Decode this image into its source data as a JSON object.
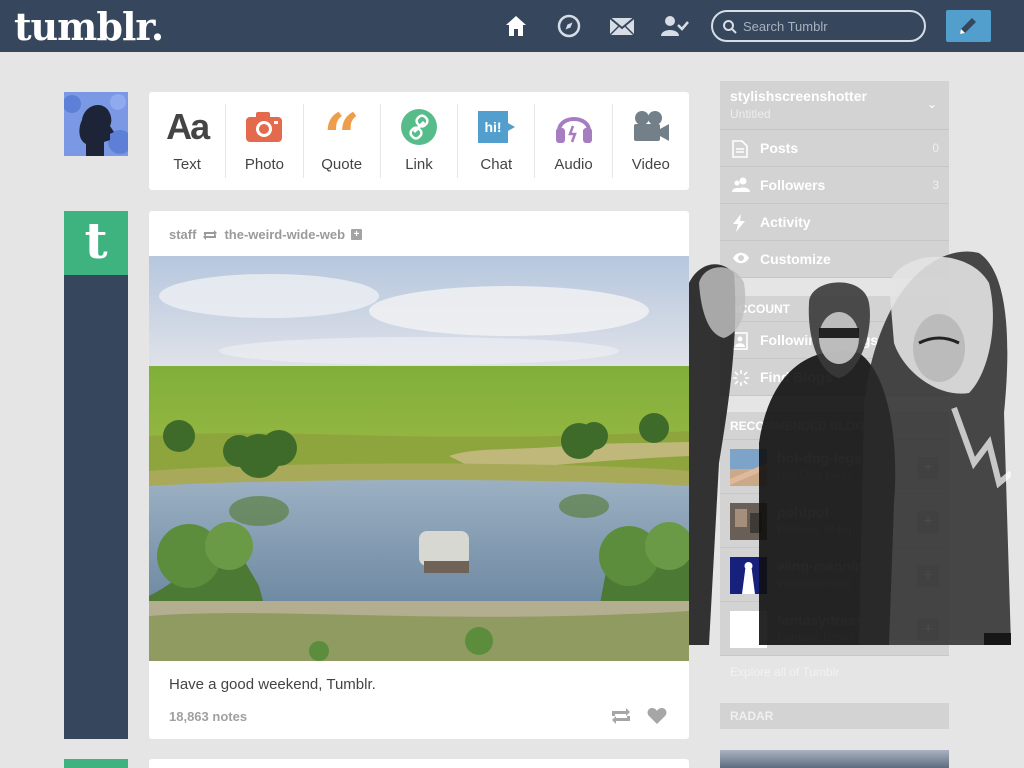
{
  "header": {
    "logo": "tumblr.",
    "search_placeholder": "Search Tumblr",
    "nav_icons": [
      "home-icon",
      "compass-icon",
      "mail-icon",
      "account-icon"
    ],
    "compose_icon": "pencil-icon",
    "colors": {
      "bar": "#36465d",
      "compose": "#529ecc"
    }
  },
  "post_types": [
    {
      "label": "Text",
      "icon": "text-icon",
      "color": "#444444"
    },
    {
      "label": "Photo",
      "icon": "camera-icon",
      "color": "#e46a4e"
    },
    {
      "label": "Quote",
      "icon": "quote-icon",
      "color": "#ef9d4b"
    },
    {
      "label": "Link",
      "icon": "link-icon",
      "color": "#56bc8a"
    },
    {
      "label": "Chat",
      "icon": "chat-icon",
      "color": "#529ecc"
    },
    {
      "label": "Audio",
      "icon": "headphones-icon",
      "color": "#a77dc2"
    },
    {
      "label": "Video",
      "icon": "video-camera-icon",
      "color": "#748089"
    }
  ],
  "post": {
    "author": "staff",
    "reblogged_from": "the-weird-wide-web",
    "caption": "Have a good weekend, Tumblr.",
    "notes": "18,863 notes"
  },
  "sidebar": {
    "blog_name": "stylishscreenshotter",
    "blog_title": "Untitled",
    "stats": [
      {
        "label": "Posts",
        "count": "0",
        "icon": "document-icon"
      },
      {
        "label": "Followers",
        "count": "3",
        "icon": "people-icon"
      },
      {
        "label": "Activity",
        "count": "",
        "icon": "lightning-icon"
      },
      {
        "label": "Customize",
        "count": "",
        "icon": "eye-icon"
      }
    ],
    "account_heading": "ACCOUNT",
    "account": [
      {
        "label": "Following 2 blogs",
        "count": "2",
        "icon": "following-icon"
      },
      {
        "label": "Find Blogs",
        "count": "",
        "icon": "sparkle-icon"
      }
    ],
    "recommended_heading": "RECOMMENDED BLOGS",
    "recommended": [
      {
        "name": "hot-dog-legs",
        "title": "Hot-Dog Legs"
      },
      {
        "name": "pohtpof",
        "title": "Pictures of Hipsters T"
      },
      {
        "name": "wing-manning",
        "title": "Wingmanning"
      },
      {
        "name": "fantasydressup",
        "title": "Fantasy Dress Up"
      }
    ],
    "explore": "Explore all of Tumblr",
    "radar_heading": "RADAR"
  }
}
